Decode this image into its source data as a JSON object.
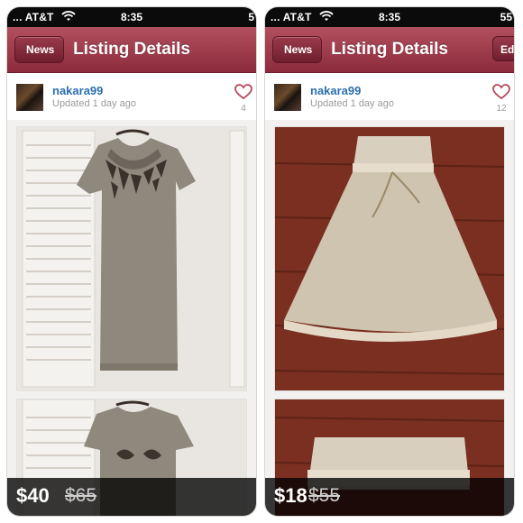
{
  "panels": [
    {
      "status": {
        "carrier": "... AT&T",
        "time": "8:35",
        "battery": "5"
      },
      "nav": {
        "back_label": "News",
        "title": "Listing Details"
      },
      "listing": {
        "username": "nakara99",
        "updated": "Updated 1 day ago",
        "likes": "4"
      },
      "price": {
        "current": "$40",
        "original": "$65"
      }
    },
    {
      "status": {
        "carrier": "... AT&T",
        "time": "8:35",
        "battery": "55"
      },
      "nav": {
        "back_label": "News",
        "title": "Listing Details",
        "edit_label": "Ed"
      },
      "listing": {
        "username": "nakara99",
        "updated": "Updated 1 day ago",
        "likes": "12"
      },
      "price": {
        "current": "$18",
        "original": "$55"
      }
    }
  ],
  "colors": {
    "nav_bar": "#9e3b4c",
    "username_link": "#2b6fae",
    "heart": "#b5485a",
    "price_bar": "#000000"
  },
  "icons": {
    "wifi": "wifi-icon",
    "like": "heart-icon",
    "back": "back-arrow-button"
  }
}
